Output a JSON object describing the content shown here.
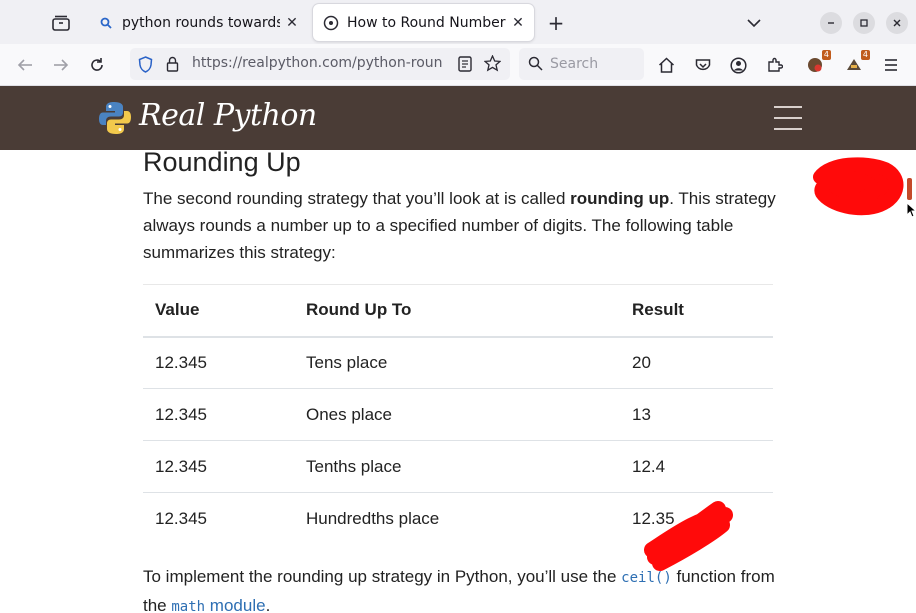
{
  "browser": {
    "tabs": [
      {
        "title": "python rounds towards p",
        "active": false
      },
      {
        "title": "How to Round Numbers i",
        "active": true
      }
    ],
    "url": "https://realpython.com/python-roun",
    "search_placeholder": "Search",
    "extension_badges": [
      "4",
      "4"
    ],
    "colors": {
      "tab_strip": "#f0f0f4",
      "nav_bar": "#f9f9fb"
    }
  },
  "site": {
    "brand": "Real Python",
    "header_color": "#4a3c36"
  },
  "article": {
    "heading": "Rounding Up",
    "intro_before": "The second rounding strategy that you’ll look at is called ",
    "intro_bold": "rounding up",
    "intro_after": ". This strategy always rounds a number up to a specified number of digits. The following table summarizes this strategy:",
    "table": {
      "headers": [
        "Value",
        "Round Up To",
        "Result"
      ],
      "rows": [
        [
          "12.345",
          "Tens place",
          "20"
        ],
        [
          "12.345",
          "Ones place",
          "13"
        ],
        [
          "12.345",
          "Tenths place",
          "12.4"
        ],
        [
          "12.345",
          "Hundredths place",
          "12.35"
        ]
      ]
    },
    "outro_before": "To implement the rounding up strategy in Python, you’ll use the ",
    "outro_code": "ceil()",
    "outro_mid": " function from the ",
    "outro_code2": "math",
    "outro_link": " module",
    "outro_end": "."
  }
}
